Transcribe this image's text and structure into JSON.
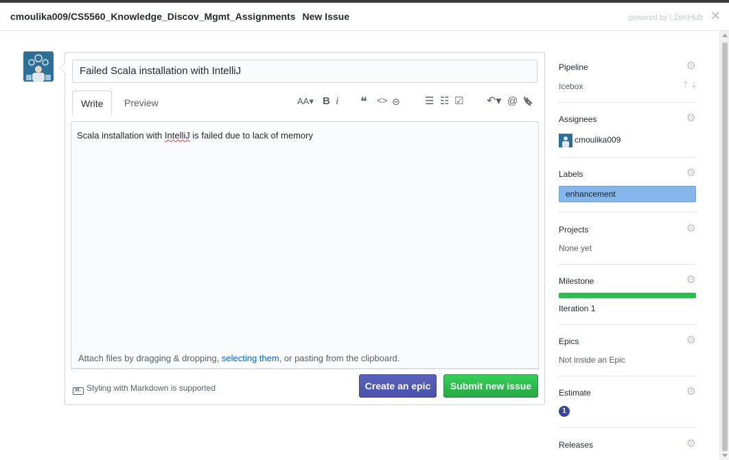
{
  "header": {
    "repo": "cmoulika009/CS5560_Knowledge_Discov_Mgmt_Assignments",
    "title": "New Issue",
    "powered_by": "powered by |",
    "brand": "ZenHub",
    "close_glyph": "✕"
  },
  "issue": {
    "title_value": "Failed Scala installation with IntelliJ",
    "tabs": {
      "write": "Write",
      "preview": "Preview"
    },
    "body_pre": "Scala installation with ",
    "body_misspelled": "IntelliJ",
    "body_post": " is failed due to lack of memory",
    "attach_pre": "Attach files by dragging & dropping, ",
    "attach_link": "selecting them",
    "attach_post": ", or pasting from the clipboard.",
    "markdown_badge": "M↓",
    "markdown_note": "Styling with Markdown is supported",
    "create_epic": "Create an epic",
    "submit": "Submit new issue"
  },
  "toolbar": {
    "text_size": "AA▾",
    "bold": "B",
    "italic": "i",
    "quote": "❝",
    "code": "<>",
    "link": "⊝",
    "bullet_list": "☰",
    "numbered_list": "☷",
    "task_list": "☑",
    "reply": "↶▾",
    "mention": "@",
    "saved_reply": "🔖"
  },
  "sidebar": {
    "gear_glyph": "⚙",
    "pipeline": {
      "label": "Pipeline",
      "value": "Icebox",
      "move_top": "⤒",
      "move_bottom": "⤓"
    },
    "assignees": {
      "label": "Assignees",
      "user": "cmoulika009"
    },
    "labels": {
      "label": "Labels",
      "tag": "enhancement",
      "tag_color": "#84b6eb"
    },
    "projects": {
      "label": "Projects",
      "value": "None yet"
    },
    "milestone": {
      "label": "Milestone",
      "value": "Iteration 1",
      "progress": 1.0,
      "bar_color": "#2cbe4e"
    },
    "epics": {
      "label": "Epics",
      "value": "Not inside an Epic"
    },
    "estimate": {
      "label": "Estimate",
      "value": "1"
    },
    "releases": {
      "label": "Releases"
    }
  },
  "colors": {
    "epic_button": "#4a51a8",
    "submit_button": "#28a745",
    "link": "#0366d6"
  }
}
